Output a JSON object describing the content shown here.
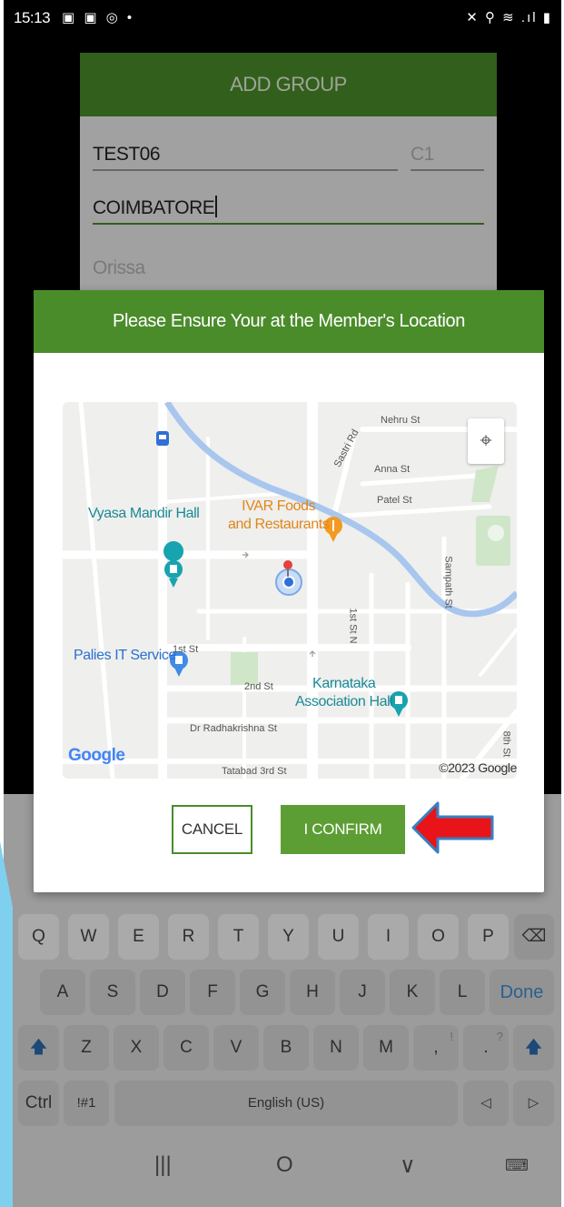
{
  "status_bar": {
    "time": "15:13",
    "left_icons": "▣ ▣ ◎ •",
    "right_icons": "✕ ⚲ ≋ .ıl ▮"
  },
  "add_group": {
    "title": "ADD GROUP",
    "group_name": "TEST06",
    "code_placeholder": "C1",
    "city_value": "COIMBATORE",
    "state_placeholder": "Orissa"
  },
  "dialog": {
    "title": "Please Ensure Your at the Member's Location",
    "cancel_label": "CANCEL",
    "confirm_label": "I CONFIRM"
  },
  "map": {
    "streets": {
      "nehru": "Nehru St",
      "sastri": "Sastri Rd",
      "anna": "Anna St",
      "patel": "Patel St",
      "sampath": "Sampath St",
      "first_st_n": "1st St N",
      "first_st": "1st St",
      "second_st": "2nd St",
      "radhakrishna": "Dr Radhakrishna St",
      "tatabad": "Tatabad 3rd St",
      "eighth": "8th St"
    },
    "pois": {
      "vyasa": "Vyasa Mandir Hall",
      "ivar_line1": "IVAR Foods",
      "ivar_line2": "and Restaurants",
      "palies": "Palies IT Service",
      "karnataka_line1": "Karnataka",
      "karnataka_line2": "Association Hall"
    },
    "google_logo": "Google",
    "copyright": "©2023 Google",
    "locate_icon": "⌖"
  },
  "keyboard": {
    "row1": [
      "Q",
      "W",
      "E",
      "R",
      "T",
      "Y",
      "U",
      "I",
      "O",
      "P"
    ],
    "row1_backspace": "⌫",
    "row2": [
      "A",
      "S",
      "D",
      "F",
      "G",
      "H",
      "J",
      "K",
      "L"
    ],
    "row2_done": "Done",
    "row3": [
      "Z",
      "X",
      "C",
      "V",
      "B",
      "N",
      "M"
    ],
    "row3_comma": ",",
    "row3_comma_alt": "!",
    "row3_period": ".",
    "row3_period_alt": "?",
    "shift_icon": "🡅",
    "ctrl": "Ctrl",
    "symbols": "!#1",
    "space": "English (US)",
    "left_arrow": "◁",
    "right_arrow": "▷"
  },
  "nav_bar": {
    "recents": "|||",
    "home": "O",
    "back": "∨",
    "keyboard_toggle": "⌨"
  },
  "colors": {
    "brand_green": "#4a8c2a",
    "confirm_green": "#5c9e34",
    "annotation_red": "#e8141a",
    "annotation_blue": "#3a7fc0"
  }
}
